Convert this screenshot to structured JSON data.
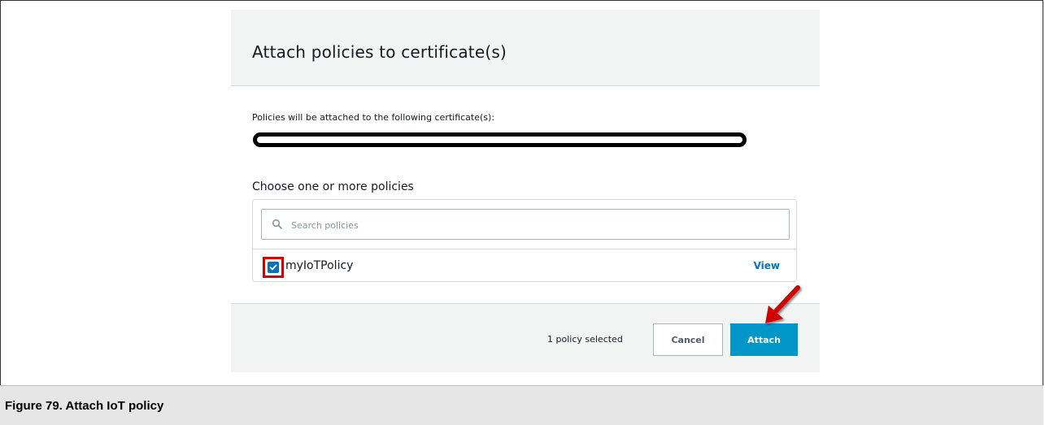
{
  "modal": {
    "title": "Attach policies to certificate(s)",
    "certificate_label": "Policies will be attached to the following certificate(s):",
    "choose_label": "Choose one or more policies",
    "search": {
      "placeholder": "Search policies",
      "value": ""
    },
    "policies": [
      {
        "name": "myIoTPolicy",
        "checked": true,
        "view_label": "View"
      }
    ],
    "footer": {
      "selected_count": "1 policy selected",
      "cancel_label": "Cancel",
      "attach_label": "Attach"
    }
  },
  "caption": "Figure 79. Attach IoT policy",
  "colors": {
    "accent": "#0073bb",
    "primary_button": "#0096c7",
    "annotation_red": "#d00000",
    "panel_gray": "#f2f3f3"
  },
  "icons": {
    "search": "search-icon",
    "check": "check-icon",
    "annotation": "red-arrow-icon"
  }
}
